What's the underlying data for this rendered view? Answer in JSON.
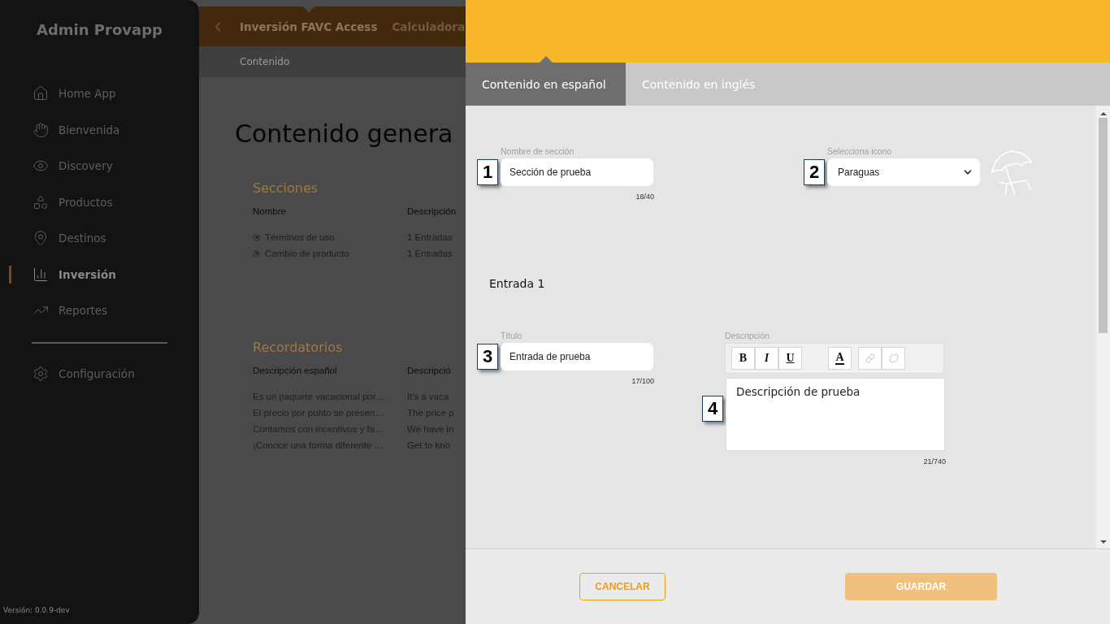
{
  "sidebar": {
    "title": "Admin Provapp",
    "items": [
      {
        "label": "Home App",
        "selected": false
      },
      {
        "label": "Bienvenida",
        "selected": false
      },
      {
        "label": "Discovery",
        "selected": false
      },
      {
        "label": "Productos",
        "selected": false
      },
      {
        "label": "Destinos",
        "selected": false
      },
      {
        "label": "Inversión",
        "selected": true
      },
      {
        "label": "Reportes",
        "selected": false
      }
    ],
    "bottom_items": [
      {
        "label": "Configuración",
        "selected": false
      }
    ],
    "version": "Versión: 0.0.9-dev"
  },
  "topbar": {
    "tabs": [
      {
        "label": "Inversión FAVC Access",
        "selected": true
      },
      {
        "label": "Calculadora",
        "selected": false
      }
    ]
  },
  "breadcrumb": "Contenido",
  "main": {
    "title": "Contenido genera",
    "sections": {
      "heading": "Secciones",
      "columns": [
        "Nombre",
        "Descripción"
      ],
      "rows": [
        [
          "Términos de uso.",
          "1 Entradas"
        ],
        [
          "Cambio de producto",
          "1 Entradas"
        ]
      ]
    },
    "reminders": {
      "heading": "Recordatorios",
      "columns": [
        "Descripción español",
        "Descripció"
      ],
      "rows": [
        [
          "Es un paquete vacacional por…",
          "It's a vaca"
        ],
        [
          "El precio por punto se presen…",
          "The price p"
        ],
        [
          "Contamos con incentivos y fa…",
          "We have in"
        ],
        [
          "¡Conoce una forma diferente …",
          "Get to kno"
        ]
      ]
    }
  },
  "drawer": {
    "tabs": [
      {
        "label": "Contenido en español",
        "selected": true
      },
      {
        "label": "Contenido en inglés",
        "selected": false
      }
    ],
    "section_name": {
      "label": "Nombre de sección",
      "value": "Sección de prueba",
      "counter": "18/40",
      "marker": "1"
    },
    "icon_select": {
      "label": "Selecciona icono",
      "value": "Paraguas",
      "marker": "2"
    },
    "entry_heading": "Entrada 1",
    "entry_title": {
      "label": "Título",
      "value": "Entrada de prueba",
      "counter": "17/100",
      "marker": "3"
    },
    "entry_description": {
      "label": "Descripción",
      "value": "Descripción de prueba",
      "counter": "21/740",
      "marker": "4",
      "toolbar": [
        {
          "kind": "bold",
          "label": "B",
          "disabled": false
        },
        {
          "kind": "italic",
          "label": "I",
          "disabled": false
        },
        {
          "kind": "underline",
          "label": "U",
          "disabled": false
        },
        {
          "kind": "color",
          "label": "A",
          "disabled": false
        },
        {
          "kind": "link",
          "disabled": true
        },
        {
          "kind": "unlink",
          "disabled": true
        }
      ]
    },
    "buttons": [
      {
        "label": "CANCELAR",
        "kind": "outline",
        "disabled": false
      },
      {
        "label": "GUARDAR",
        "kind": "filled",
        "disabled": true
      }
    ]
  }
}
